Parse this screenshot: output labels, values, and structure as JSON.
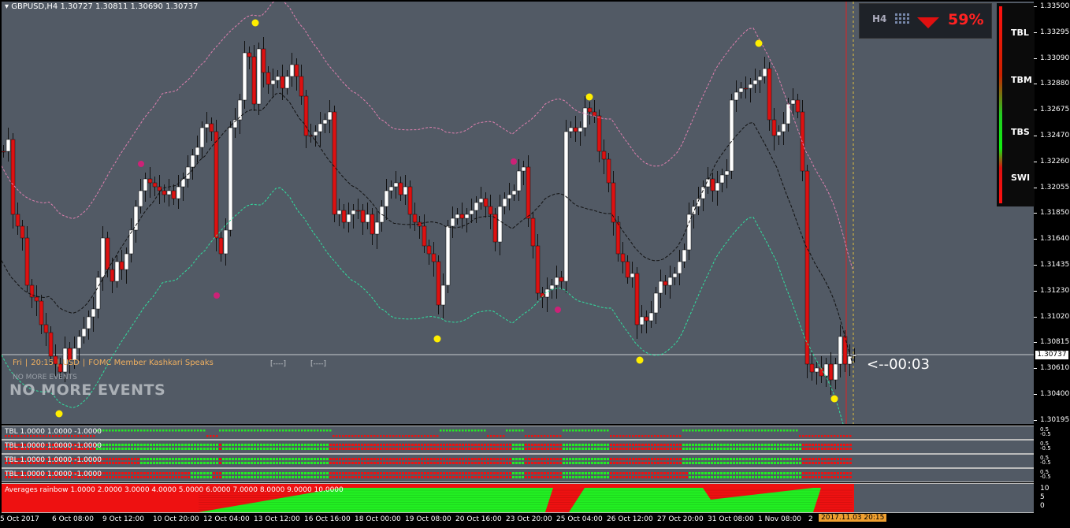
{
  "symbol_bar": {
    "symbol": "GBPUSD,H4",
    "ohlc": "1.30727 1.30811 1.30690 1.30737"
  },
  "price_axis": [
    "1.33500",
    "1.33295",
    "1.33090",
    "1.32880",
    "1.32675",
    "1.32470",
    "1.32260",
    "1.32055",
    "1.31850",
    "1.31640",
    "1.31435",
    "1.31230",
    "1.31020",
    "1.30815",
    "1.30610",
    "1.30400",
    "1.30195"
  ],
  "current_price": "1.30737",
  "time_axis": [
    "5 Oct 2017",
    "6 Oct 08:00",
    "9 Oct 12:00",
    "10 Oct 20:00",
    "12 Oct 04:00",
    "13 Oct 12:00",
    "16 Oct 16:00",
    "18 Oct 00:00",
    "19 Oct 08:00",
    "20 Oct 16:00",
    "23 Oct 20:00",
    "25 Oct 04:00",
    "26 Oct 12:00",
    "27 Oct 20:00",
    "31 Oct 08:00",
    "1 Nov 08:00",
    "2"
  ],
  "time_current": "2017.11.03 20:15",
  "news": {
    "day": "Fri",
    "time": "20:15",
    "currency": "USD",
    "event": "FOMC Member Kashkari Speaks",
    "dash1": "[----]",
    "dash2": "[----]",
    "sep": "|"
  },
  "no_more_events_small": "NO MORE EVENTS",
  "no_more_events_big": "NO MORE EVENTS",
  "timer": "<--00:03",
  "signal": {
    "percent": "59%",
    "timeframe": "H4",
    "direction": "down"
  },
  "indicator_levels": [
    "TBL",
    "TBM",
    "TBS",
    "SWI"
  ],
  "sub_panels": [
    {
      "label": "TBL 1.0000 1.0000 -1.0000",
      "scale": [
        "0.5",
        "-0.5"
      ]
    },
    {
      "label": "TBL 1.0000 1.0000 -1.0000",
      "scale": [
        "0.5",
        "-0.5"
      ]
    },
    {
      "label": "TBL 1.0000 1.0000 -1.0000",
      "scale": [
        "0.5",
        "-0.5"
      ]
    },
    {
      "label": "TBL 1.0000 1.0000 -1.0000",
      "scale": [
        "0.5",
        "-0.5"
      ]
    }
  ],
  "rainbow": {
    "label": "Averages rainbow 1.0000 2.0000 3.0000 4.0000 5.0000 6.0000 7.0000 8.0000 9.0000 10.0000",
    "scale": [
      "10",
      "5",
      "0"
    ]
  },
  "colors": {
    "chart_bg": "#525a65",
    "bull": "#ffffff",
    "bear": "#dd1111",
    "up_signal": "#22ee22",
    "down_signal": "#ee1111",
    "fractal_high": "#ffee00",
    "fractal_pink": "#cc2277"
  }
}
